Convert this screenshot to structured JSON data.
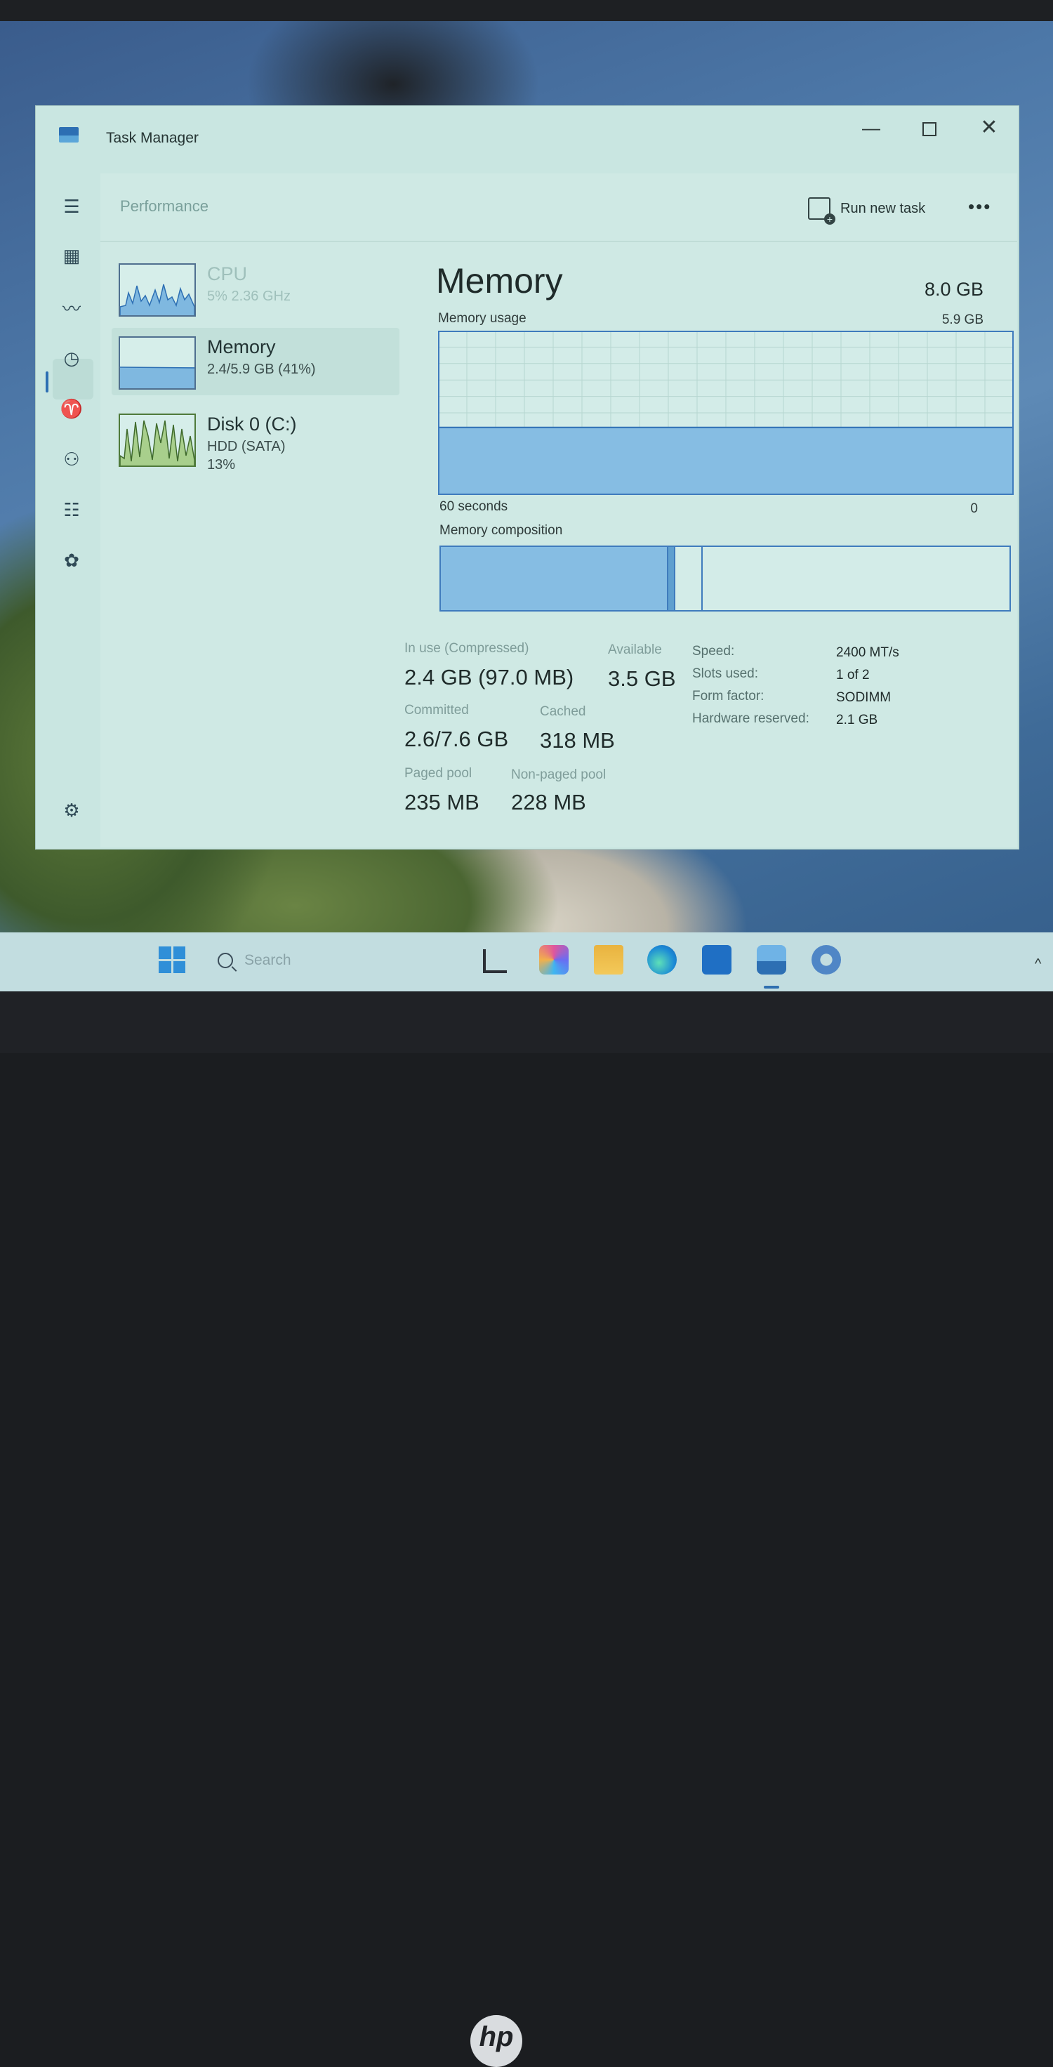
{
  "window": {
    "title": "Task Manager",
    "minimize": "—",
    "close": "✕"
  },
  "header": {
    "section": "Performance",
    "run_new_task": "Run new task",
    "more": "•••"
  },
  "devices": [
    {
      "name": "CPU",
      "sub": "5%  2.36 GHz"
    },
    {
      "name": "Memory",
      "sub": "2.4/5.9 GB (41%)"
    },
    {
      "name": "Disk 0 (C:)",
      "sub": "HDD (SATA)",
      "sub2": "13%"
    }
  ],
  "memory": {
    "title": "Memory",
    "total": "8.0 GB",
    "usage_label": "Memory usage",
    "usage_max": "5.9 GB",
    "time_left": "60 seconds",
    "time_right": "0",
    "composition_label": "Memory composition",
    "usage_fraction": 0.41,
    "composition": {
      "in_use": 0.4,
      "modified": 0.01,
      "standby": 0.045
    },
    "stats": {
      "in_use_label": "In use (Compressed)",
      "in_use_value": "2.4 GB (97.0 MB)",
      "available_label": "Available",
      "available_value": "3.5 GB",
      "committed_label": "Committed",
      "committed_value": "2.6/7.6 GB",
      "cached_label": "Cached",
      "cached_value": "318 MB",
      "paged_label": "Paged pool",
      "paged_value": "235 MB",
      "nonpaged_label": "Non-paged pool",
      "nonpaged_value": "228 MB"
    },
    "details": {
      "speed_label": "Speed:",
      "speed_value": "2400 MT/s",
      "slots_label": "Slots used:",
      "slots_value": "1 of 2",
      "form_label": "Form factor:",
      "form_value": "SODIMM",
      "hw_label": "Hardware reserved:",
      "hw_value": "2.1 GB"
    }
  },
  "taskbar": {
    "search_placeholder": "Search",
    "apps": [
      "task-view-icon",
      "copilot-icon",
      "file-explorer-icon",
      "edge-icon",
      "store-icon",
      "task-manager-icon",
      "settings-icon"
    ]
  },
  "colors": {
    "accent": "#2d6fb3",
    "memory_fill": "#7fb8e0",
    "window_bg": "#c9e6e1"
  },
  "brand": "hp"
}
